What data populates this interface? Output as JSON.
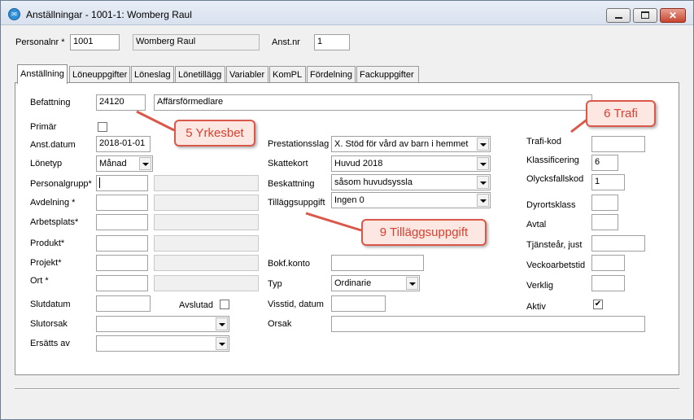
{
  "window": {
    "title": "Anställningar - 1001-1: Womberg Raul",
    "icon": "app-icon",
    "buttons": {
      "minimize": "minimize-icon",
      "maximize": "maximize-icon",
      "close": "close-icon"
    }
  },
  "header": {
    "personalnr_label": "Personalnr *",
    "personalnr_value": "1001",
    "name_value": "Womberg Raul",
    "anstnr_label": "Anst.nr",
    "anstnr_value": "1"
  },
  "tabs": [
    {
      "label": "Anställning",
      "active": true
    },
    {
      "label": "Löneuppgifter"
    },
    {
      "label": "Löneslag"
    },
    {
      "label": "Lönetillägg"
    },
    {
      "label": "Variabler"
    },
    {
      "label": "KomPL"
    },
    {
      "label": "Fördelning"
    },
    {
      "label": "Fackuppgifter"
    }
  ],
  "form": {
    "befattning_label": "Befattning",
    "befattning_code": "24120",
    "befattning_text": "Affärsförmedlare",
    "primar_label": "Primär",
    "anstdatum_label": "Anst.datum",
    "anstdatum_value": "2018-01-01",
    "lonetyp_label": "Lönetyp",
    "lonetyp_value": "Månad",
    "personalgrupp_label": "Personalgrupp*",
    "avdelning_label": "Avdelning *",
    "arbetsplats_label": "Arbetsplats*",
    "produkt_label": "Produkt*",
    "projekt_label": "Projekt*",
    "ort_label": "Ort *",
    "slutdatum_label": "Slutdatum",
    "avslutad_label": "Avslutad",
    "slutorsak_label": "Slutorsak",
    "ersatts_label": "Ersätts av",
    "prestationsslag_label": "Prestationsslag",
    "prestationsslag_value": "X. Stöd för vård av barn i hemmet",
    "skattekort_label": "Skattekort",
    "skattekort_value": "Huvud 2018",
    "beskattning_label": "Beskattning",
    "beskattning_value": "såsom huvudsyssla",
    "tillaggsuppgift_label": "Tilläggsuppgift",
    "tillaggsuppgift_value": "Ingen 0",
    "bokfkonto_label": "Bokf.konto",
    "typ_label": "Typ",
    "typ_value": "Ordinarie",
    "visstid_label": "Visstid, datum",
    "orsak_label": "Orsak",
    "trafikod_label": "Trafi-kod",
    "klassificering_label": "Klassificering",
    "klassificering_value": "6",
    "olycksfallskod_label": "Olycksfallskod",
    "olycksfallskod_value": "1",
    "dyrortsklass_label": "Dyrortsklass",
    "avtal_label": "Avtal",
    "tjanstear_label": "Tjänsteår, just",
    "veckoarbetstid_label": "Veckoarbetstid",
    "verklig_label": "Verklig",
    "aktiv_label": "Aktiv",
    "aktiv_checked": true,
    "primar_checked": false,
    "avslutad_checked": false
  },
  "callouts": {
    "yrkesbet": "5 Yrkesbet",
    "trafi": "6 Trafi",
    "tillagg": "9 Tilläggsuppgift"
  },
  "colors": {
    "callout_border": "#d9584a",
    "callout_fill": "#fde7e3",
    "callout_text": "#d9402f"
  }
}
